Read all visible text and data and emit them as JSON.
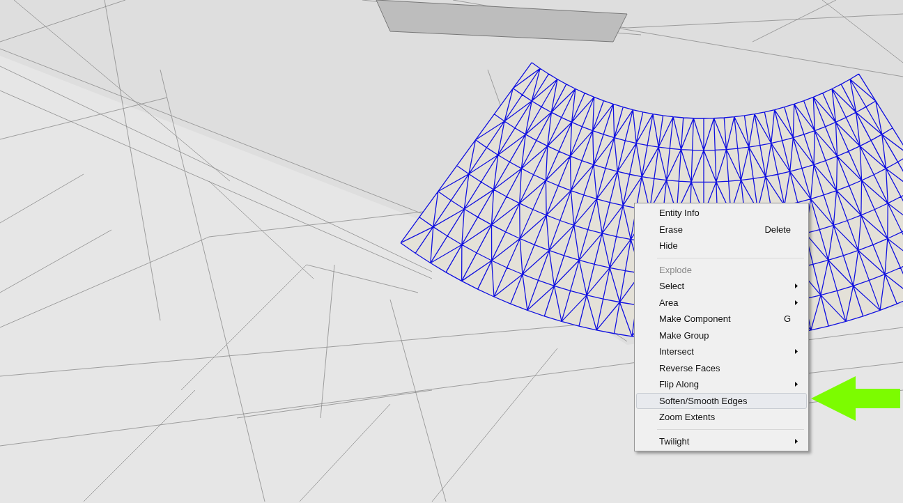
{
  "context_menu": {
    "groups": [
      [
        {
          "label": "Entity Info",
          "submenu": false,
          "disabled": false,
          "selected": false
        },
        {
          "label": "Erase",
          "shortcut": "Delete",
          "submenu": false,
          "disabled": false,
          "selected": false
        },
        {
          "label": "Hide",
          "submenu": false,
          "disabled": false,
          "selected": false
        }
      ],
      [
        {
          "label": "Explode",
          "submenu": false,
          "disabled": true,
          "selected": false
        },
        {
          "label": "Select",
          "submenu": true,
          "disabled": false,
          "selected": false
        },
        {
          "label": "Area",
          "submenu": true,
          "disabled": false,
          "selected": false
        },
        {
          "label": "Make Component",
          "shortcut": "G",
          "submenu": false,
          "disabled": false,
          "selected": false
        },
        {
          "label": "Make Group",
          "submenu": false,
          "disabled": false,
          "selected": false
        },
        {
          "label": "Intersect",
          "submenu": true,
          "disabled": false,
          "selected": false
        },
        {
          "label": "Reverse Faces",
          "submenu": false,
          "disabled": false,
          "selected": false
        },
        {
          "label": "Flip Along",
          "submenu": true,
          "disabled": false,
          "selected": false
        },
        {
          "label": "Soften/Smooth Edges",
          "submenu": false,
          "disabled": false,
          "selected": true
        },
        {
          "label": "Zoom Extents",
          "submenu": false,
          "disabled": false,
          "selected": false
        }
      ],
      [
        {
          "label": "Twilight",
          "submenu": true,
          "disabled": false,
          "selected": false
        }
      ]
    ]
  }
}
